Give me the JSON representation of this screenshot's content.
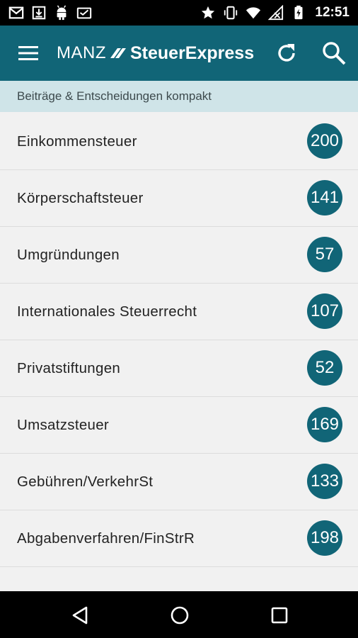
{
  "status_bar": {
    "time": "12:51",
    "icons": [
      "gmail-icon",
      "download-icon",
      "android-icon",
      "inbox-icon",
      "star-icon",
      "vibrate-icon",
      "wifi-icon",
      "no-signal-icon",
      "battery-charging-icon"
    ]
  },
  "app_bar": {
    "brand": "MANZ",
    "product": "SteuerExpress",
    "icons": [
      "menu-icon",
      "refresh-icon",
      "search-icon"
    ],
    "color": "#116577"
  },
  "subheader": {
    "text": "Beiträge & Entscheidungen kompakt",
    "background": "#cfe4e8"
  },
  "categories": [
    {
      "label": "Einkommensteuer",
      "count": "200"
    },
    {
      "label": "Körperschaftsteuer",
      "count": "141"
    },
    {
      "label": "Umgründungen",
      "count": "57"
    },
    {
      "label": "Internationales Steuerrecht",
      "count": "107"
    },
    {
      "label": "Privatstiftungen",
      "count": "52"
    },
    {
      "label": "Umsatzsteuer",
      "count": "169"
    },
    {
      "label": "Gebühren/VerkehrSt",
      "count": "133"
    },
    {
      "label": "Abgabenverfahren/FinStrR",
      "count": "198"
    }
  ],
  "nav_bar": {
    "icons": [
      "back-icon",
      "home-icon",
      "recents-icon"
    ]
  }
}
